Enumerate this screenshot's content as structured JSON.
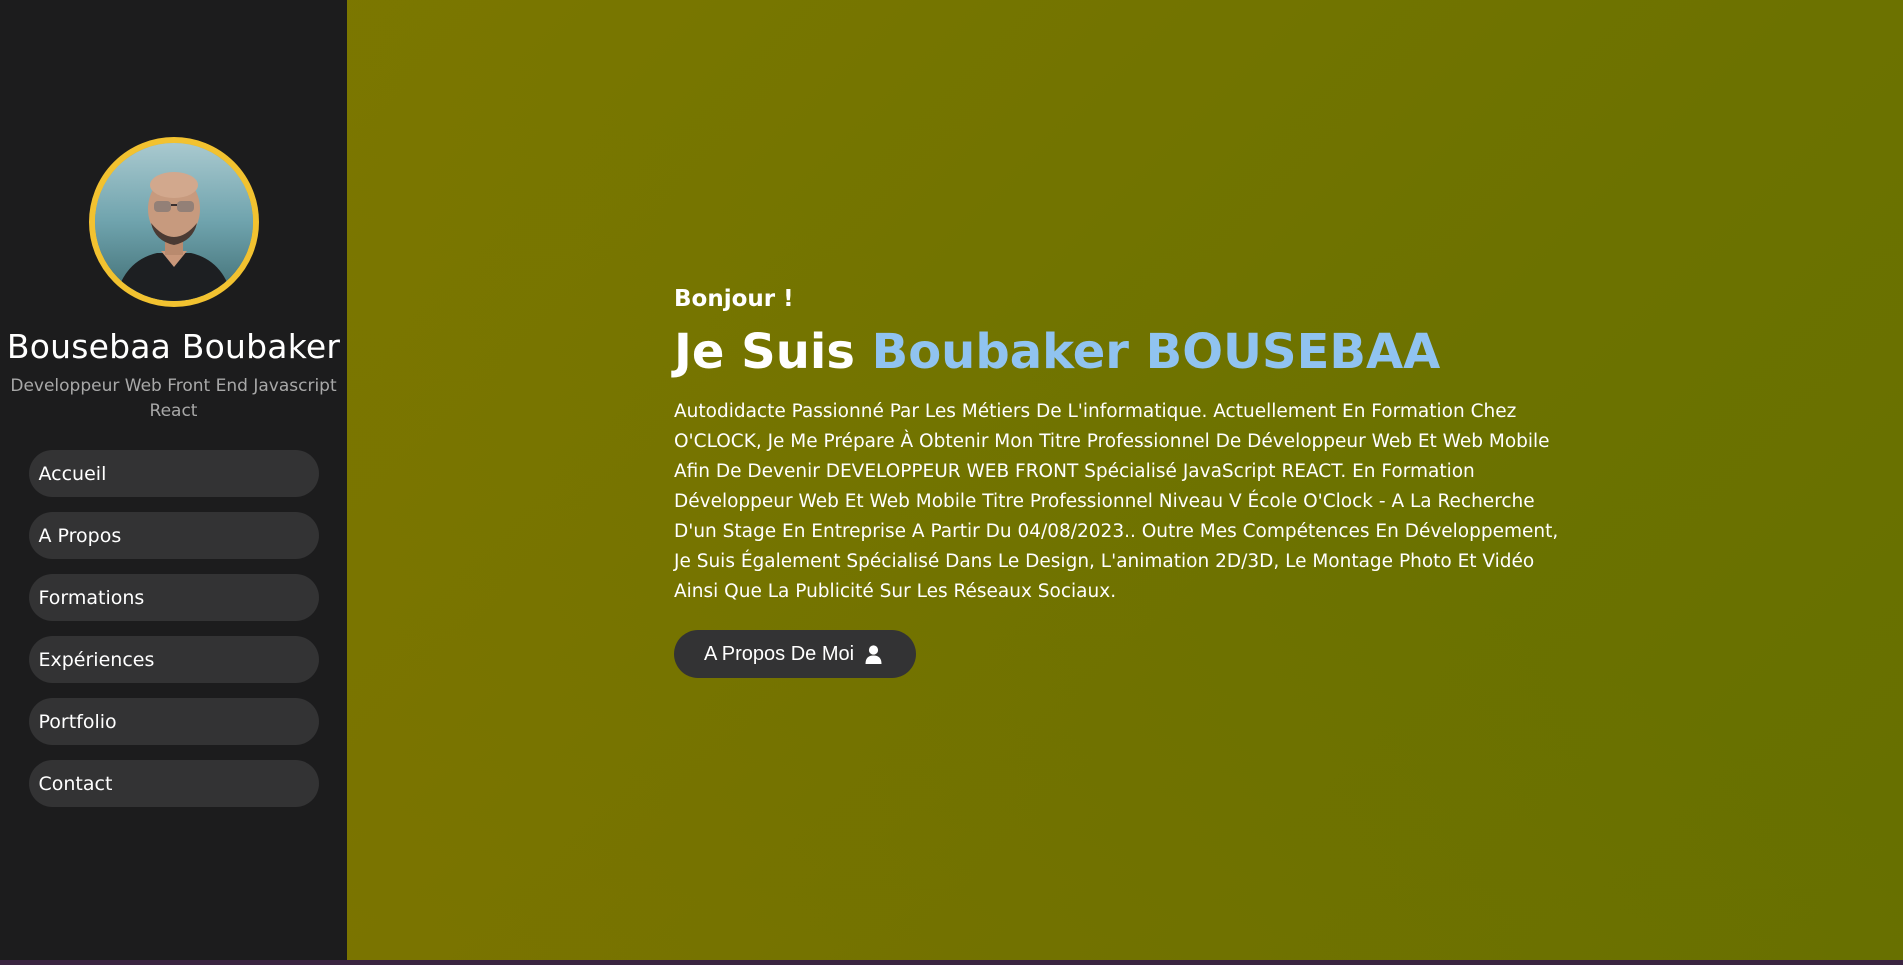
{
  "sidebar": {
    "avatar_alt": "",
    "name": "Bousebaa Boubaker",
    "role": "Developpeur Web Front End Javascript React",
    "nav": [
      {
        "label": "Accueil"
      },
      {
        "label": "A Propos"
      },
      {
        "label": "Formations"
      },
      {
        "label": "Expériences"
      },
      {
        "label": "Portfolio"
      },
      {
        "label": "Contact"
      }
    ]
  },
  "hero": {
    "greeting": "Bonjour !",
    "headline_prefix": "Je Suis ",
    "headline_name": "Boubaker BOUSEBAA",
    "bio": "Autodidacte Passionné Par Les Métiers De L'informatique. Actuellement En Formation Chez O'CLOCK, Je Me Prépare À Obtenir Mon Titre Professionnel De Développeur Web Et Web Mobile Afin De Devenir DEVELOPPEUR WEB FRONT Spécialisé JavaScript REACT. En Formation Développeur Web Et Web Mobile Titre Professionnel Niveau V École O'Clock - A La Recherche D'un Stage En Entreprise A Partir Du 04/08/2023.. Outre Mes Compétences En Développement, Je Suis Également Spécialisé Dans Le Design, L'animation 2D/3D, Le Montage Photo Et Vidéo Ainsi Que La Publicité Sur Les Réseaux Sociaux.",
    "cta_label": "A Propos De Moi",
    "cta_icon": "user-icon"
  },
  "colors": {
    "sidebar_bg": "#1c1c1d",
    "pill_bg": "#333334",
    "avatar_ring": "#f2c230",
    "accent_name": "#90c3f0",
    "main_bg": "#737400"
  }
}
